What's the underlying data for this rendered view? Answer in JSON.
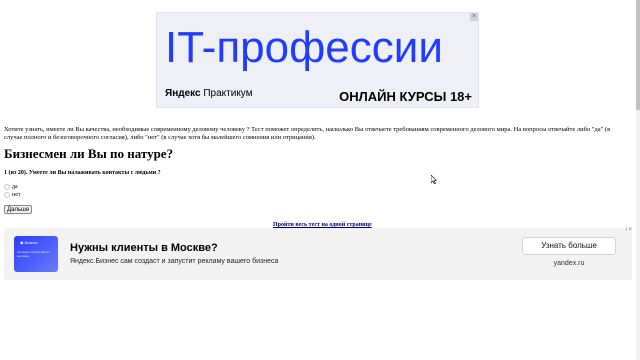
{
  "top_ad": {
    "headline": "IT-профессии",
    "brand_bold": "Яндекс",
    "brand_rest": " Практикум",
    "cta": "ОНЛАЙН КУРСЫ 18+",
    "close_label": "×"
  },
  "article": {
    "intro": "Хотите узнать, имеете ли Вы качества, необходимые современному деловому человеку ? Тест поможет определить, насколько Вы отвечаете требованиям современного делового мира. На вопросы отвечайте либо \"да\" (в случае полного и безоговорочного согласия), либо \"нет\" (в случае хотя бы малейшего сомнения или отрицания).",
    "title": "Бизнесмен ли Вы по натуре?",
    "question": "1 (из 20). Умеете ли Вы налаживать контакты с людьми ?",
    "options": [
      "да",
      "нет"
    ],
    "next_label": "Дальше",
    "one_page_link": "Пройти весь тест на одной странице"
  },
  "bottom_ad": {
    "thumb_badge": "◉ Бизнес",
    "thumb_text": "Автоматический запуск рекламы",
    "title": "Нужны клиенты в Москве?",
    "description": "Яндекс.Бизнес сам создаст и запустит рекламу вашего бизнеса",
    "button": "Узнать больше",
    "domain": "yandex.ru",
    "icons": "i ×"
  },
  "colors": {
    "ad_blue": "#1f3cff",
    "link": "#00007a"
  }
}
